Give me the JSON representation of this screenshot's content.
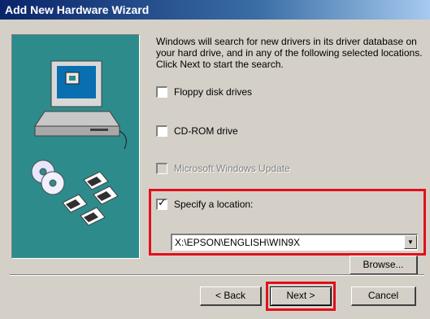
{
  "window": {
    "title": "Add New Hardware Wizard"
  },
  "intro_text": "Windows will search for new drivers in its driver database on your hard drive, and in any of the following selected locations. Click Next to start the search.",
  "options": {
    "floppy": {
      "label": "Floppy disk drives",
      "checked": false
    },
    "cdrom": {
      "label": "CD-ROM drive",
      "checked": false
    },
    "windows_update": {
      "label": "Microsoft Windows Update",
      "checked": false,
      "disabled": true
    },
    "specify": {
      "label": "Specify a location:",
      "checked": true
    }
  },
  "location": {
    "value": "X:\\EPSON\\ENGLISH\\WIN9X"
  },
  "buttons": {
    "browse": "Browse...",
    "back": "< Back",
    "next": "Next >",
    "cancel": "Cancel"
  },
  "colors": {
    "title_bar": "#0a246a",
    "highlight": "#e0101a",
    "art_background": "#2d8b8b",
    "dialog": "#d4d0c8"
  }
}
